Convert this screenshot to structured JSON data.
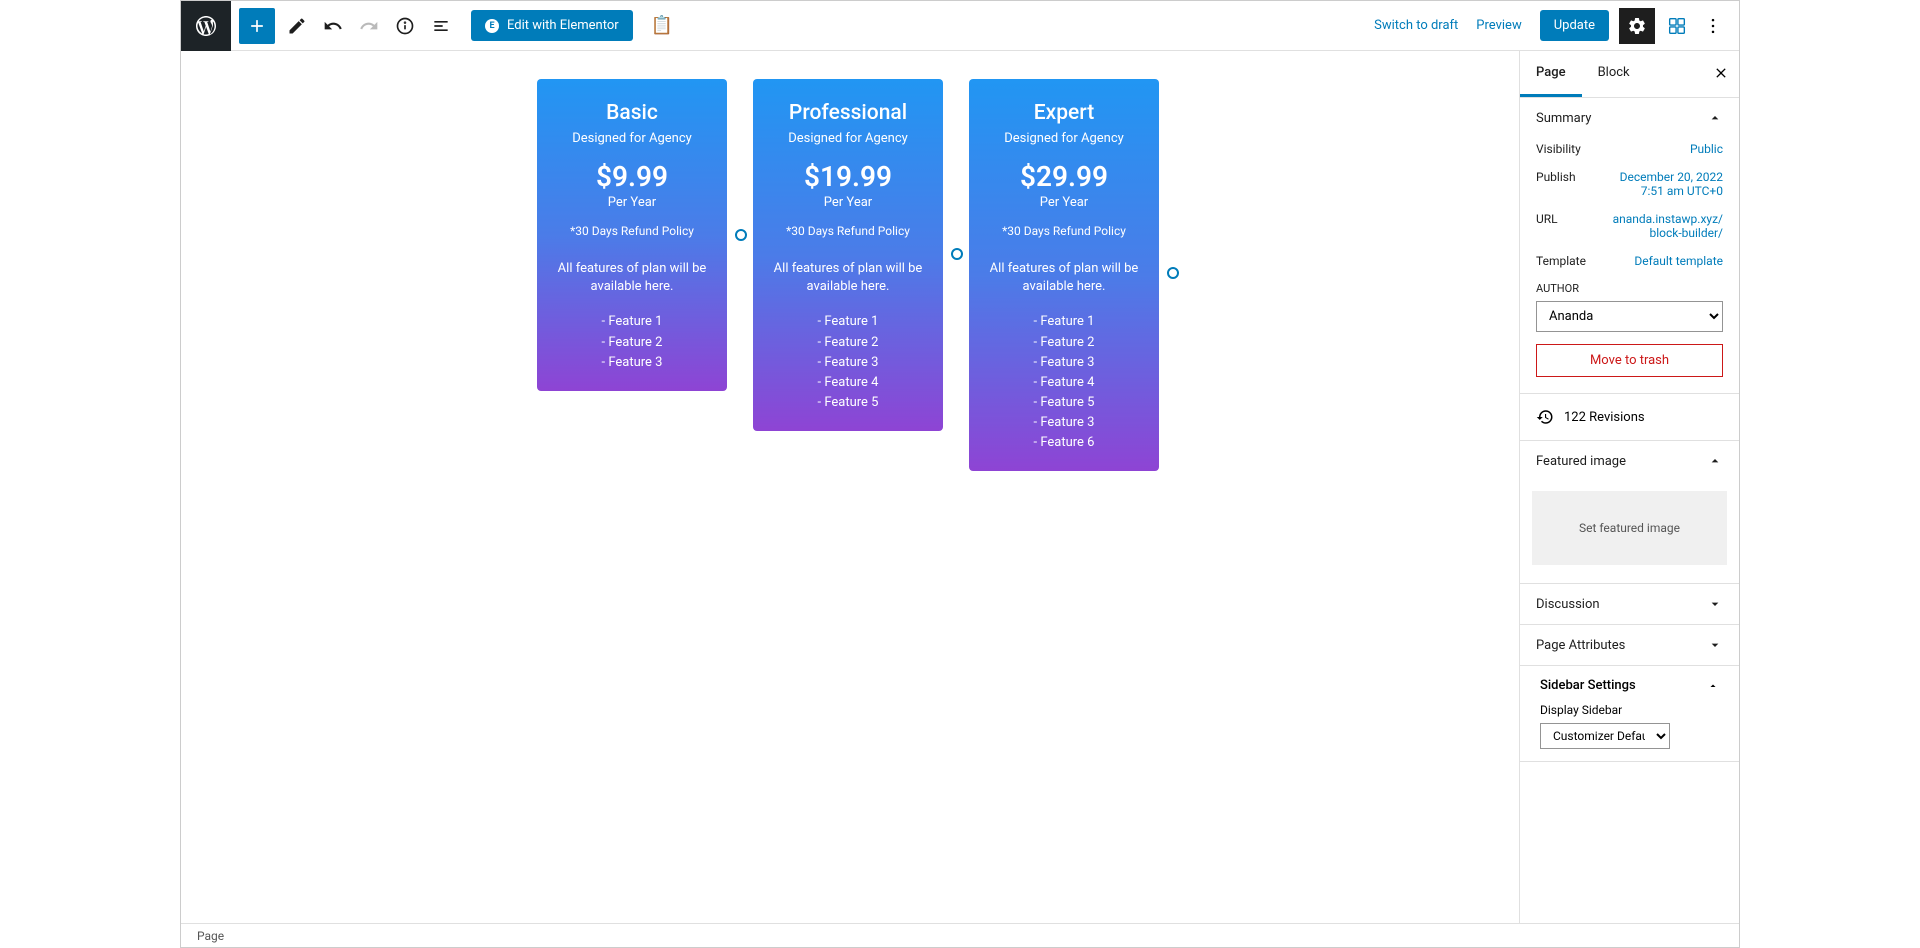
{
  "toolbar": {
    "elementor_label": "Edit with Elementor",
    "switch_draft": "Switch to draft",
    "preview": "Preview",
    "update": "Update"
  },
  "cards": [
    {
      "title": "Basic",
      "subtitle": "Designed for Agency",
      "price": "$9.99",
      "period": "Per Year",
      "refund": "*30 Days Refund Policy",
      "desc": "All features of plan will be available here.",
      "features": [
        "- Feature 1",
        "- Feature 2",
        "- Feature 3"
      ]
    },
    {
      "title": "Professional",
      "subtitle": "Designed for Agency",
      "price": "$19.99",
      "period": "Per Year",
      "refund": "*30 Days Refund Policy",
      "desc": "All features of plan will be available here.",
      "features": [
        "- Feature 1",
        "- Feature 2",
        "- Feature 3",
        "- Feature 4",
        "- Feature 5"
      ]
    },
    {
      "title": "Expert",
      "subtitle": "Designed for Agency",
      "price": "$29.99",
      "period": "Per Year",
      "refund": "*30 Days Refund Policy",
      "desc": "All features of plan will be available here.",
      "features": [
        "- Feature 1",
        "- Feature 2",
        "- Feature 3",
        "- Feature 4",
        "- Feature 5",
        "- Feature 3",
        "- Feature 6"
      ]
    }
  ],
  "sidebar": {
    "tabs": {
      "page": "Page",
      "block": "Block"
    },
    "summary": {
      "title": "Summary",
      "visibility_label": "Visibility",
      "visibility_value": "Public",
      "publish_label": "Publish",
      "publish_value": "December 20, 2022 7:51 am UTC+0",
      "url_label": "URL",
      "url_value": "ananda.instawp.xyz/block-builder/",
      "template_label": "Template",
      "template_value": "Default template",
      "author_label": "AUTHOR",
      "author_value": "Ananda",
      "trash": "Move to trash"
    },
    "revisions": "122 Revisions",
    "featured": {
      "title": "Featured image",
      "placeholder": "Set featured image"
    },
    "discussion": "Discussion",
    "page_attributes": "Page Attributes",
    "sidebar_settings": {
      "title": "Sidebar Settings",
      "display_label": "Display Sidebar",
      "display_value": "Customizer Default"
    }
  },
  "footer": {
    "breadcrumb": "Page"
  }
}
